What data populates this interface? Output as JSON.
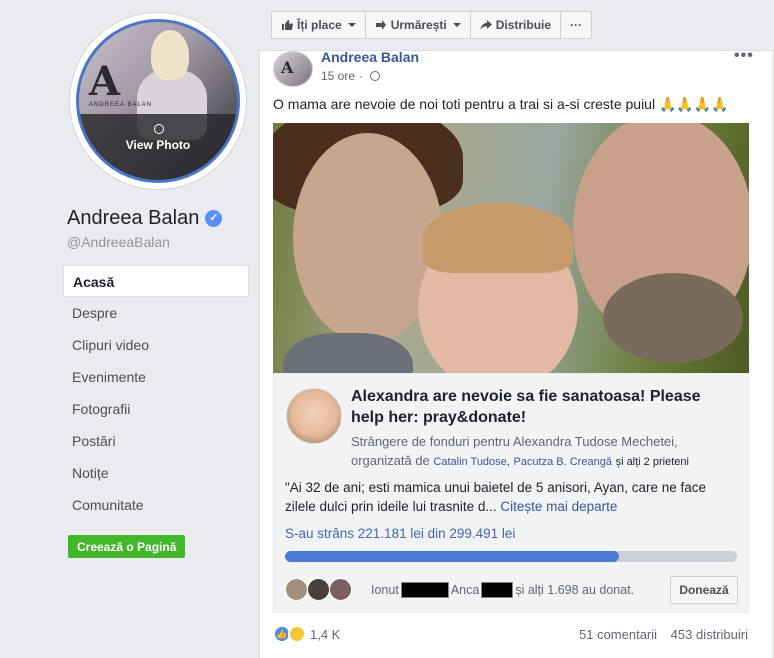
{
  "profile": {
    "view_photo": "View Photo",
    "name": "Andreea Balan",
    "handle": "@AndreeaBalan",
    "logo_letter": "A",
    "logo_text": "ANDREEA BALAN"
  },
  "nav": [
    {
      "label": "Acasă",
      "active": true
    },
    {
      "label": "Despre"
    },
    {
      "label": "Clipuri video"
    },
    {
      "label": "Evenimente"
    },
    {
      "label": "Fotografii"
    },
    {
      "label": "Postări"
    },
    {
      "label": "Notițe"
    },
    {
      "label": "Comunitate"
    }
  ],
  "create_page": "Creează o Pagină",
  "actions": {
    "like": "Îți place",
    "follow": "Urmărești",
    "share": "Distribuie",
    "more": "···"
  },
  "post": {
    "author": "Andreea Balan",
    "time": "15 ore",
    "more": "•••",
    "text": "O mama are nevoie de noi toti pentru a trai si a-si creste puiul",
    "emoji": "🙏🙏🙏🙏"
  },
  "fundraiser": {
    "title": "Alexandra are nevoie sa fie sanatoasa! Please help her: pray&donate!",
    "sub_prefix": "Strângere de fonduri pentru Alexandra Tudose Mechetei, organizată de",
    "organizer1": "Catalin Tudose",
    "organizer2": "Pacutza B. Creangă",
    "sub_suffix": "și alți 2 prieteni",
    "desc": "\"Ai 32 de ani; esti mamica unui baietel de 5 anisori, Ayan, care ne face zilele dulci prin ideile lui trasnite d...",
    "read_more": "Citește mai departe",
    "raised": "S-au strâns 221.181 lei din 299.491 lei",
    "progress_percent": 73.9,
    "donor1": "Ionut",
    "donor2": "Anca",
    "donor_suffix": "și alți 1.698 au donat.",
    "donate": "Donează"
  },
  "footer": {
    "reactions": "1,4 K",
    "comments": "51 comentarii",
    "shares": "453 distribuiri"
  },
  "colors": {
    "link": "#385898",
    "accent": "#4267b2",
    "green": "#42b72a"
  }
}
